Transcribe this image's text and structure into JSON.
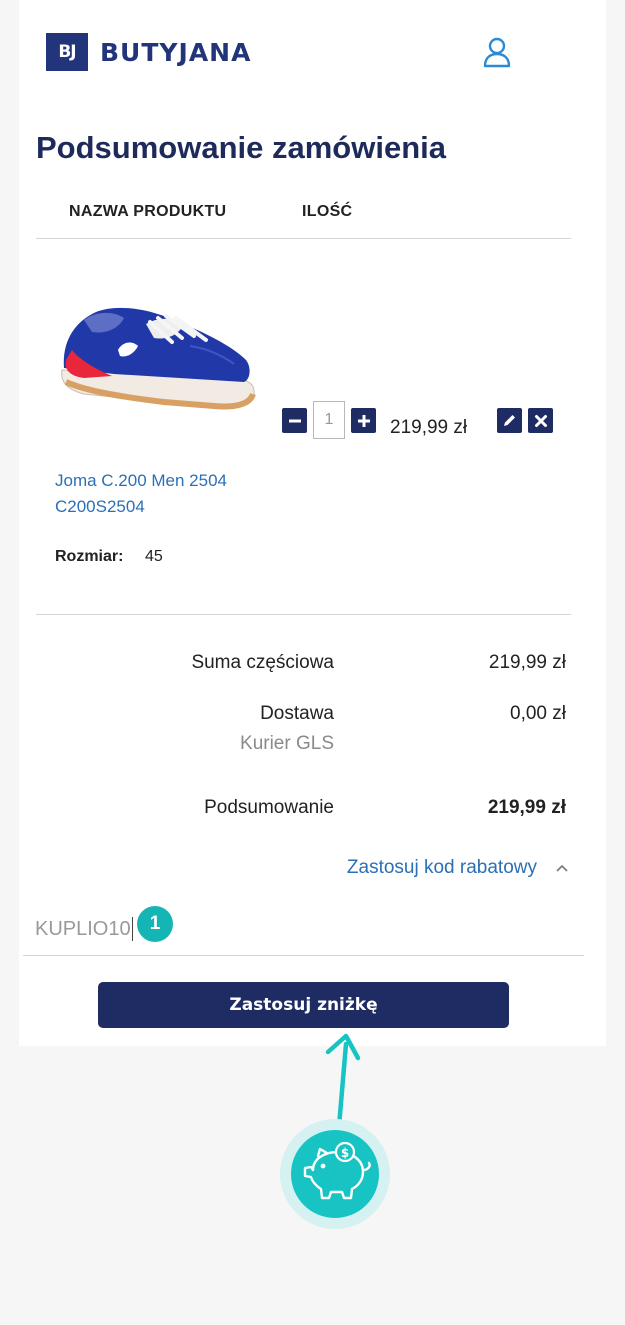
{
  "brand": {
    "mark": "BJ",
    "name": "BUTYJANA"
  },
  "page": {
    "title": "Podsumowanie zamówienia"
  },
  "table": {
    "col_product": "NAZWA PRODUKTU",
    "col_qty": "ILOŚĆ"
  },
  "product": {
    "name_line1": "Joma C.200 Men 2504",
    "name_line2": "C200S2504",
    "quantity": "1",
    "price": "219,99 zł",
    "size_label": "Rozmiar:",
    "size_value": "45"
  },
  "summary": {
    "subtotal_label": "Suma częściowa",
    "subtotal_value": "219,99 zł",
    "shipping_label": "Dostawa",
    "shipping_method": "Kurier GLS",
    "shipping_value": "0,00 zł",
    "total_label": "Podsumowanie",
    "total_value": "219,99 zł"
  },
  "discount": {
    "link_label": "Zastosuj kod rabatowy",
    "code_value": "KUPLIO10",
    "step_badge": "1",
    "apply_label": "Zastosuj zniżkę"
  },
  "icons": [
    "user-icon",
    "minus-icon",
    "plus-icon",
    "edit-icon",
    "delete-icon",
    "chevron-up-icon",
    "piggy-bank-icon",
    "coin-icon",
    "arrow-up-icon"
  ],
  "colors": {
    "brand_navy": "#1f2c63",
    "link_blue": "#2b6fb6",
    "accent_teal": "#14b5b5"
  }
}
